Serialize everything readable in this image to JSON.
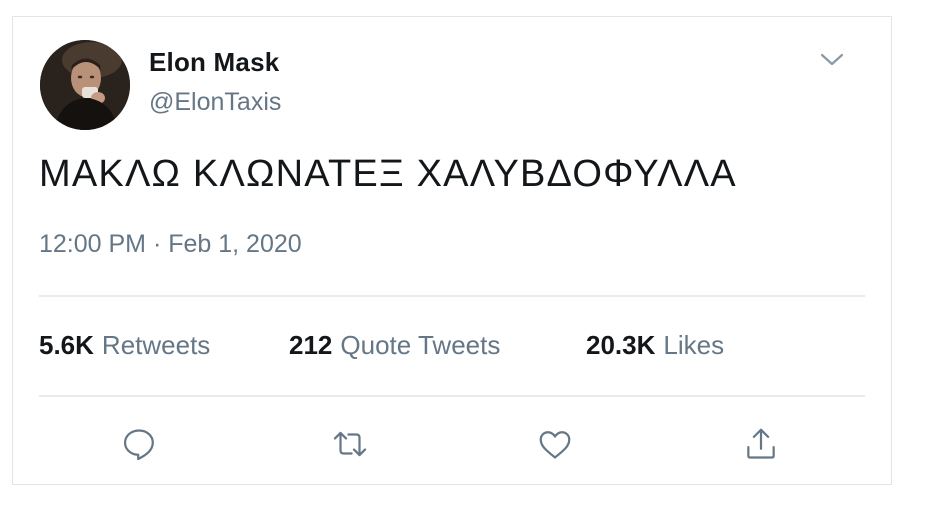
{
  "tweet": {
    "author": {
      "name": "Elon Mask",
      "handle": "@ElonTaxis",
      "avatar_icon": "avatar-photo"
    },
    "menu_icon": "chevron-down-icon",
    "text": "ΜΑΚΛΩ ΚΛΩΝΑΤΕΞ ΧΑΛΥΒΔΟΦΥΛΛΑ",
    "timestamp": "12:00 PM · Feb 1, 2020",
    "stats": {
      "retweets": {
        "count": "5.6K",
        "label": "Retweets"
      },
      "quote_tweets": {
        "count": "212",
        "label": "Quote Tweets"
      },
      "likes": {
        "count": "20.3K",
        "label": "Likes"
      }
    },
    "actions": [
      "reply-icon",
      "retweet-icon",
      "like-icon",
      "share-icon"
    ],
    "colors": {
      "primary_text": "#14171a",
      "secondary_text": "#657786",
      "border": "#e6ecf0"
    }
  }
}
